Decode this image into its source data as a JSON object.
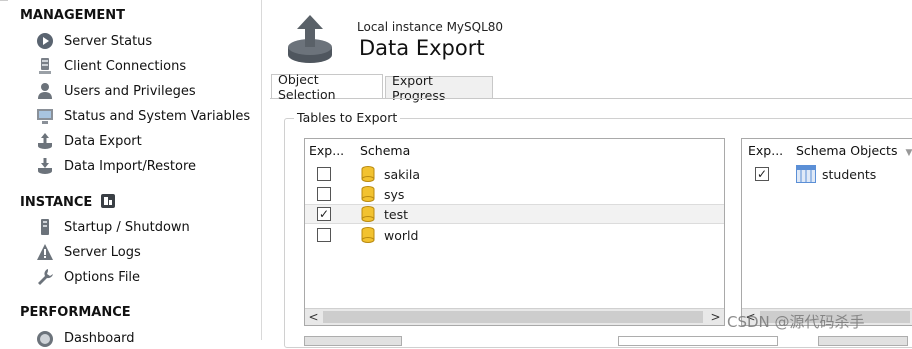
{
  "sidebar": {
    "management": {
      "title": "MANAGEMENT",
      "items": [
        {
          "label": "Server Status",
          "icon": "server-status-icon"
        },
        {
          "label": "Client Connections",
          "icon": "client-connections-icon"
        },
        {
          "label": "Users and Privileges",
          "icon": "users-icon"
        },
        {
          "label": "Status and System Variables",
          "icon": "monitor-icon"
        },
        {
          "label": "Data Export",
          "icon": "data-export-icon"
        },
        {
          "label": "Data Import/Restore",
          "icon": "data-import-icon"
        }
      ]
    },
    "instance": {
      "title": "INSTANCE",
      "items": [
        {
          "label": "Startup / Shutdown",
          "icon": "startup-icon"
        },
        {
          "label": "Server Logs",
          "icon": "warning-icon"
        },
        {
          "label": "Options File",
          "icon": "wrench-icon"
        }
      ]
    },
    "performance": {
      "title": "PERFORMANCE",
      "items": [
        {
          "label": "Dashboard",
          "icon": "dashboard-icon"
        }
      ]
    }
  },
  "header": {
    "subtitle": "Local instance MySQL80",
    "title": "Data Export"
  },
  "tabs": [
    {
      "label": "Object Selection",
      "active": true
    },
    {
      "label": "Export Progress",
      "active": false
    }
  ],
  "tables_to_export": {
    "group_label": "Tables to Export",
    "schema_list": {
      "col_export": "Exp...",
      "col_schema": "Schema",
      "rows": [
        {
          "name": "sakila",
          "checked": false
        },
        {
          "name": "sys",
          "checked": false
        },
        {
          "name": "test",
          "checked": true,
          "selected": true
        },
        {
          "name": "world",
          "checked": false
        }
      ]
    },
    "objects_list": {
      "col_export": "Exp...",
      "col_objects": "Schema Objects",
      "rows": [
        {
          "name": "students",
          "checked": true
        }
      ]
    }
  },
  "watermark": "CSDN @源代码杀手",
  "colors": {
    "db_icon": "#f2c230",
    "table_icon": "#5b8fd6",
    "border": "#a9a9a9"
  }
}
